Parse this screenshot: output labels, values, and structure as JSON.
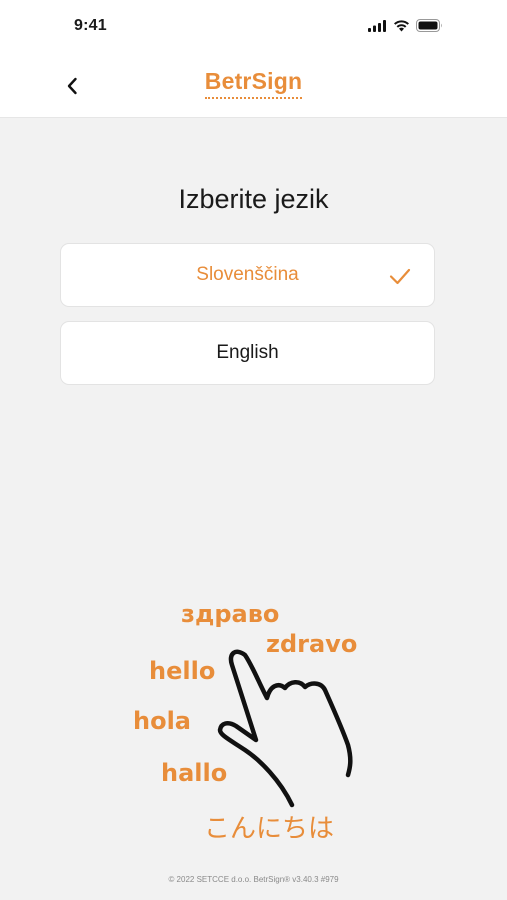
{
  "status_bar": {
    "time": "9:41"
  },
  "header": {
    "back_icon": "chevron-left-icon",
    "brand": "BetrSign"
  },
  "main": {
    "title": "Izberite jezik",
    "languages": [
      {
        "label": "Slovenščina",
        "selected": true
      },
      {
        "label": "English",
        "selected": false
      }
    ]
  },
  "illustration": {
    "words": [
      "здраво",
      "zdravo",
      "hello",
      "hola",
      "hallo",
      "こんにちは"
    ]
  },
  "footer": {
    "copyright": "© 2022 SETCCE d.o.o. BetrSign® v3.40.3 #979"
  },
  "colors": {
    "accent": "#e88d3a",
    "background": "#f2f2f2"
  }
}
